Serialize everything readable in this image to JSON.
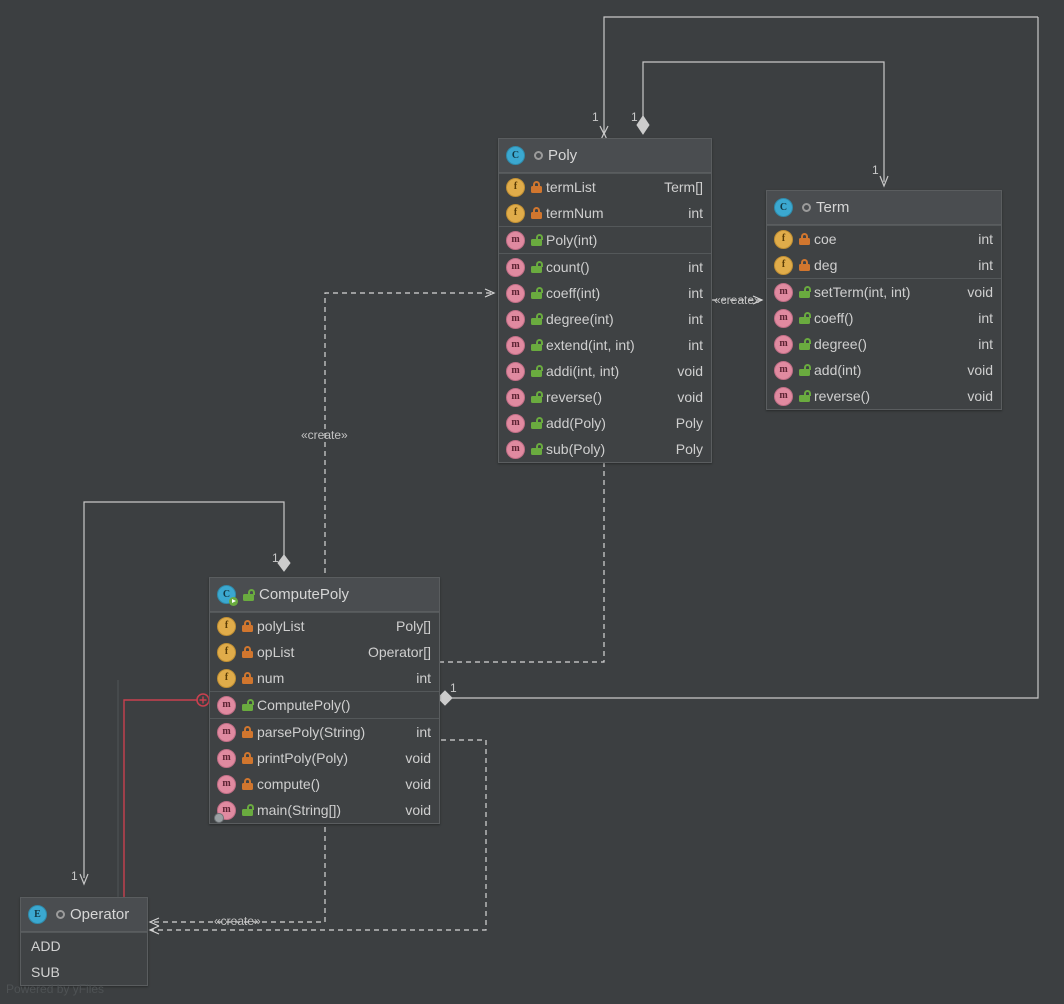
{
  "diagram": {
    "type": "uml-class-diagram",
    "watermark": "Powered by yFiles",
    "background_color": "#3c3f41",
    "node_header_color": "#4a4d50",
    "node_body_color": "#3f4244",
    "edge_color": "#c8c8c8",
    "highlight_edge_color": "#c9404f"
  },
  "classes": {
    "poly": {
      "name": "Poly",
      "kind": "class",
      "icon": "class-icon",
      "visibility": "public",
      "fields": [
        {
          "name": "termList",
          "type": "Term[]",
          "visibility": "private",
          "icon": "field-icon"
        },
        {
          "name": "termNum",
          "type": "int",
          "visibility": "private",
          "icon": "field-icon"
        }
      ],
      "constructors": [
        {
          "name": "Poly(int)",
          "type": "",
          "visibility": "public",
          "icon": "method-icon"
        }
      ],
      "methods": [
        {
          "name": "count()",
          "type": "int",
          "visibility": "public",
          "icon": "method-icon"
        },
        {
          "name": "coeff(int)",
          "type": "int",
          "visibility": "public",
          "icon": "method-icon"
        },
        {
          "name": "degree(int)",
          "type": "int",
          "visibility": "public",
          "icon": "method-icon"
        },
        {
          "name": "extend(int, int)",
          "type": "int",
          "visibility": "public",
          "icon": "method-icon"
        },
        {
          "name": "addi(int, int)",
          "type": "void",
          "visibility": "public",
          "icon": "method-icon"
        },
        {
          "name": "reverse()",
          "type": "void",
          "visibility": "public",
          "icon": "method-icon"
        },
        {
          "name": "add(Poly)",
          "type": "Poly",
          "visibility": "public",
          "icon": "method-icon"
        },
        {
          "name": "sub(Poly)",
          "type": "Poly",
          "visibility": "public",
          "icon": "method-icon"
        }
      ]
    },
    "term": {
      "name": "Term",
      "kind": "class",
      "icon": "class-icon",
      "visibility": "public",
      "fields": [
        {
          "name": "coe",
          "type": "int",
          "visibility": "private",
          "icon": "field-icon"
        },
        {
          "name": "deg",
          "type": "int",
          "visibility": "private",
          "icon": "field-icon"
        }
      ],
      "constructors": [],
      "methods": [
        {
          "name": "setTerm(int, int)",
          "type": "void",
          "visibility": "public",
          "icon": "method-icon"
        },
        {
          "name": "coeff()",
          "type": "int",
          "visibility": "public",
          "icon": "method-icon"
        },
        {
          "name": "degree()",
          "type": "int",
          "visibility": "public",
          "icon": "method-icon"
        },
        {
          "name": "add(int)",
          "type": "void",
          "visibility": "public",
          "icon": "method-icon"
        },
        {
          "name": "reverse()",
          "type": "void",
          "visibility": "public",
          "icon": "method-icon"
        }
      ]
    },
    "computepoly": {
      "name": "ComputePoly",
      "kind": "class",
      "icon": "runnable-class-icon",
      "visibility": "public",
      "fields": [
        {
          "name": "polyList",
          "type": "Poly[]",
          "visibility": "private",
          "icon": "field-icon"
        },
        {
          "name": "opList",
          "type": "Operator[]",
          "visibility": "private",
          "icon": "field-icon"
        },
        {
          "name": "num",
          "type": "int",
          "visibility": "private",
          "icon": "field-icon"
        }
      ],
      "constructors": [
        {
          "name": "ComputePoly()",
          "type": "",
          "visibility": "public",
          "icon": "method-icon"
        }
      ],
      "methods": [
        {
          "name": "parsePoly(String)",
          "type": "int",
          "visibility": "private",
          "icon": "method-icon"
        },
        {
          "name": "printPoly(Poly)",
          "type": "void",
          "visibility": "private",
          "icon": "method-icon"
        },
        {
          "name": "compute()",
          "type": "void",
          "visibility": "private",
          "icon": "method-icon"
        },
        {
          "name": "main(String[])",
          "type": "void",
          "visibility": "public",
          "icon": "main-method-icon"
        }
      ]
    },
    "operator": {
      "name": "Operator",
      "kind": "enum",
      "icon": "enum-icon",
      "visibility": "public",
      "values": [
        "ADD",
        "SUB"
      ]
    }
  },
  "edges": {
    "stereotype_create": "«create»",
    "multiplicity_one": "1",
    "labels": [
      {
        "id": "mult-poly-top-left",
        "text": "1"
      },
      {
        "id": "mult-poly-top-diamond",
        "text": "1"
      },
      {
        "id": "mult-term-top",
        "text": "1"
      },
      {
        "id": "mult-computepoly-top",
        "text": "1"
      },
      {
        "id": "mult-computepoly-right",
        "text": "1"
      },
      {
        "id": "mult-operator-top",
        "text": "1"
      },
      {
        "id": "create-poly-term",
        "text": "«create»"
      },
      {
        "id": "create-computepoly-poly",
        "text": "«create»"
      },
      {
        "id": "create-computepoly-operator",
        "text": "«create»"
      }
    ]
  }
}
